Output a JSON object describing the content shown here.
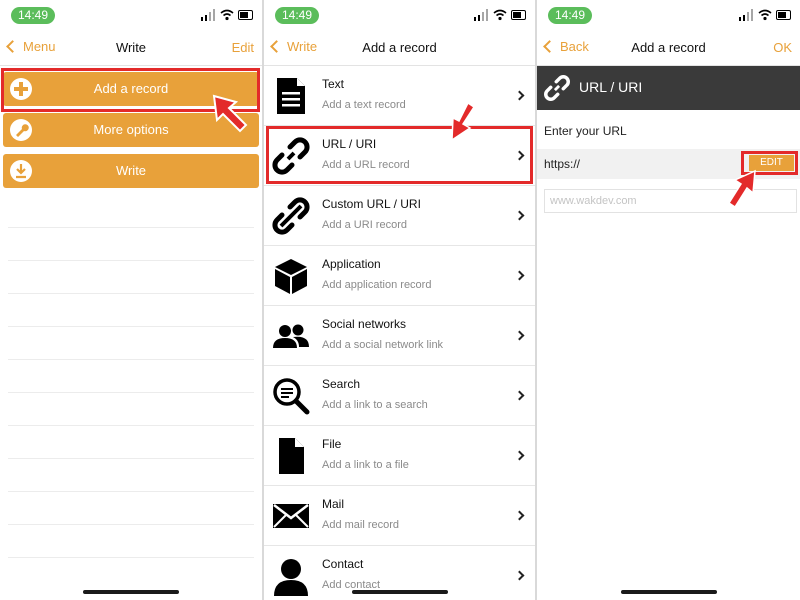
{
  "colors": {
    "accent": "#e8a13a",
    "highlight": "#e32a2a",
    "dark_header": "#3a3a3a",
    "status_green": "#5bbd5b"
  },
  "status": {
    "time": "14:49"
  },
  "panel1": {
    "nav": {
      "back_label": "Menu",
      "title": "Write",
      "right_label": "Edit"
    },
    "buttons": [
      {
        "label": "Add a record",
        "icon": "plus-circle-icon"
      },
      {
        "label": "More options",
        "icon": "wrench-icon"
      },
      {
        "label": "Write",
        "icon": "download-icon"
      }
    ]
  },
  "panel2": {
    "nav": {
      "back_label": "Write",
      "title": "Add a record"
    },
    "records": [
      {
        "title": "Text",
        "subtitle": "Add a text record",
        "icon": "document-icon"
      },
      {
        "title": "URL / URI",
        "subtitle": "Add a URL record",
        "icon": "link-icon"
      },
      {
        "title": "Custom URL / URI",
        "subtitle": "Add a URI record",
        "icon": "custom-link-icon"
      },
      {
        "title": "Application",
        "subtitle": "Add application record",
        "icon": "cube-icon"
      },
      {
        "title": "Social networks",
        "subtitle": "Add a social network link",
        "icon": "people-icon"
      },
      {
        "title": "Search",
        "subtitle": "Add a link to a search",
        "icon": "search-icon"
      },
      {
        "title": "File",
        "subtitle": "Add a link to a file",
        "icon": "file-icon"
      },
      {
        "title": "Mail",
        "subtitle": "Add mail record",
        "icon": "envelope-icon"
      },
      {
        "title": "Contact",
        "subtitle": "Add contact",
        "icon": "person-icon"
      }
    ]
  },
  "panel3": {
    "nav": {
      "back_label": "Back",
      "title": "Add a record",
      "right_label": "OK"
    },
    "header_title": "URL / URI",
    "field_label": "Enter your URL",
    "prefix_value": "https://",
    "edit_label": "EDIT",
    "url_placeholder": "www.wakdev.com"
  }
}
